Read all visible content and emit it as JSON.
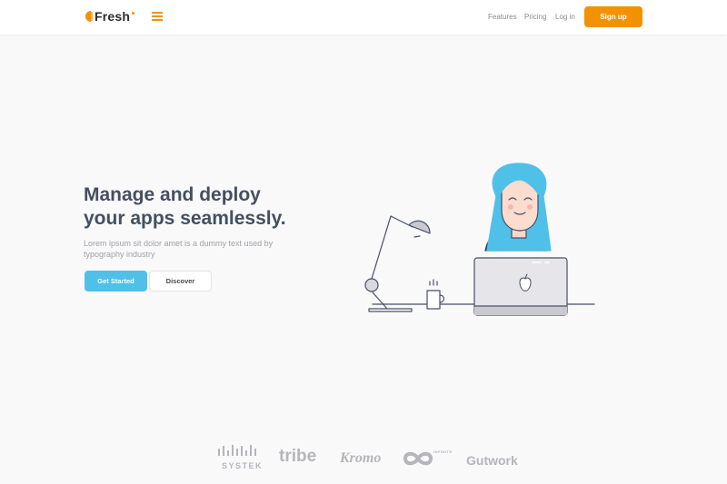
{
  "nav": {
    "brand": "Fresh",
    "links": [
      "Features",
      "Pricing",
      "Log in"
    ],
    "signup_label": "Sign up"
  },
  "hero": {
    "title_line1": "Manage and deploy",
    "title_line2": "your apps seamlessly.",
    "subtitle": "Lorem ipsum sit dolor amet is a dummy text used by typography industry",
    "primary_button": "Get Started",
    "secondary_button": "Discover"
  },
  "brands": {
    "systek": "SYSTEK",
    "tribe": "tribe",
    "kromo": "Kromo",
    "infinite": "INFINITE",
    "gutwork": "Gutwork"
  },
  "colors": {
    "accent": "#f39200",
    "primary": "#4fc1e9",
    "title": "#444f60",
    "background": "#f9f9fa"
  },
  "icons": [
    "logo-mark-icon",
    "hamburger-menu-icon",
    "apple-logo-icon"
  ]
}
